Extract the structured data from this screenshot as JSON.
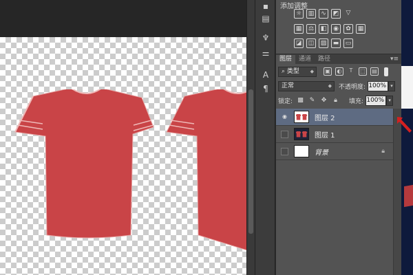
{
  "adjustments": {
    "title": "添加调整"
  },
  "layers_panel": {
    "tabs": [
      "图层",
      "通道",
      "路径"
    ],
    "filter_kind": "类型",
    "blend_mode": "正常",
    "opacity_label": "不透明度:",
    "opacity_value": "100%",
    "lock_label": "锁定:",
    "fill_label": "填充:",
    "fill_value": "100%",
    "layers": [
      {
        "name": "图层 2",
        "visible": true,
        "selected": true
      },
      {
        "name": "图层 1",
        "visible": false,
        "selected": false
      },
      {
        "name": "背景",
        "visible": false,
        "selected": false,
        "locked": true
      }
    ]
  },
  "colors": {
    "shirt": "#c94447",
    "selected_layer": "#5e6b82",
    "arrow": "#d42020"
  }
}
